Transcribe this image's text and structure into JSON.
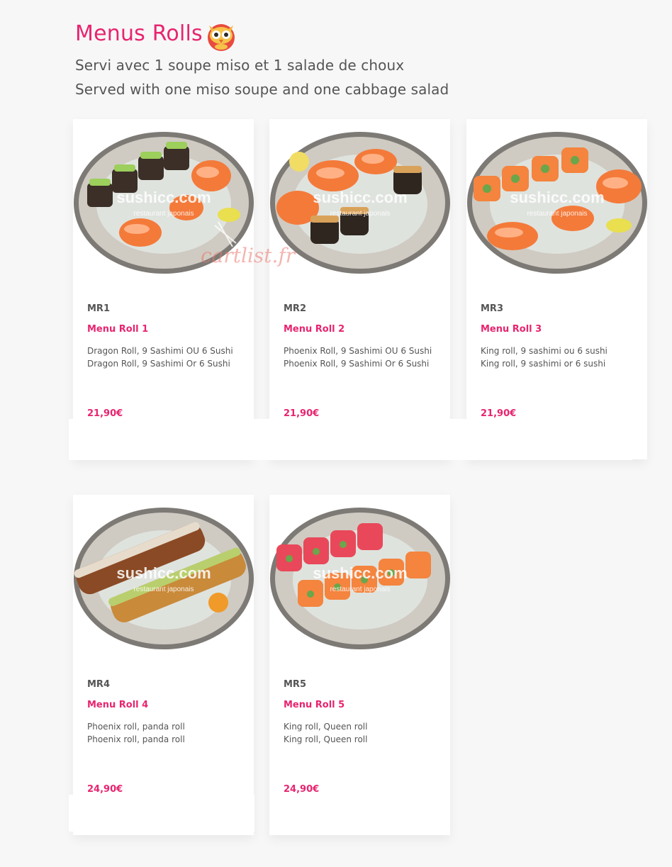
{
  "header": {
    "title": "Menus Rolls",
    "subtitle_fr": "Servi avec 1 soupe miso et 1 salade de choux",
    "subtitle_en": "Served with one miso soupe and one cabbage salad",
    "mascot_icon": "owl-mascot-icon"
  },
  "watermark": {
    "brand": "sushicc.com",
    "tagline": "restaurant japonais",
    "overlay": "cartlist.fr"
  },
  "colors": {
    "accent": "#e8246f",
    "text": "#555555",
    "background": "#f7f7f7"
  },
  "items": [
    {
      "code": "MR1",
      "name": "Menu Roll 1",
      "desc_fr": "Dragon Roll, 9 Sashimi OU 6 Sushi",
      "desc_en": "Dragon Roll, 9 Sashimi Or 6 Sushi",
      "price": "21,90€"
    },
    {
      "code": "MR2",
      "name": "Menu Roll 2",
      "desc_fr": "Phoenix Roll, 9 Sashimi OU 6 Sushi",
      "desc_en": "Phoenix Roll, 9 Sashimi Or 6 Sushi",
      "price": "21,90€"
    },
    {
      "code": "MR3",
      "name": "Menu Roll 3",
      "desc_fr": "King roll, 9 sashimi ou 6 sushi",
      "desc_en": "King roll, 9 sashimi or 6 sushi",
      "price": "21,90€"
    },
    {
      "code": "MR4",
      "name": "Menu Roll 4",
      "desc_fr": "Phoenix roll, panda roll",
      "desc_en": "Phoenix roll, panda roll",
      "price": "24,90€"
    },
    {
      "code": "MR5",
      "name": "Menu Roll 5",
      "desc_fr": "King roll, Queen roll",
      "desc_en": "King roll, Queen roll",
      "price": "24,90€"
    }
  ]
}
